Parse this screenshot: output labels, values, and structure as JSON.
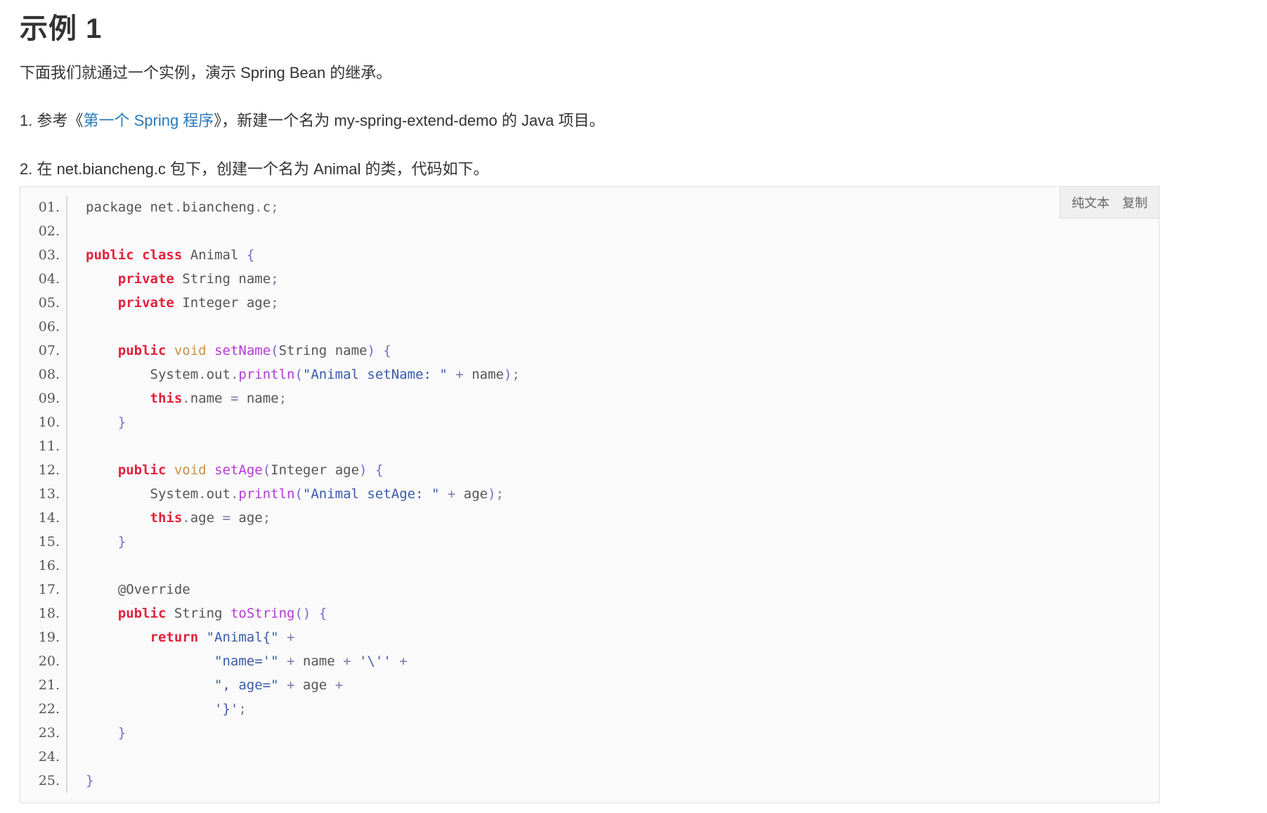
{
  "heading": "示例 1",
  "intro": "下面我们就通过一个实例，演示 Spring Bean 的继承。",
  "step1": {
    "prefix": "1. 参考《",
    "link": "第一个 Spring 程序",
    "suffix": "》，新建一个名为 my-spring-extend-demo 的 Java 项目。"
  },
  "step2": "2. 在 net.biancheng.c 包下，创建一个名为 Animal 的类，代码如下。",
  "toolbar": {
    "plain_text": "纯文本",
    "copy": "复制"
  },
  "code_lines": [
    {
      "n": "01.",
      "t": "package net.biancheng.c;"
    },
    {
      "n": "02.",
      "t": ""
    },
    {
      "n": "03.",
      "t": "public class Animal {"
    },
    {
      "n": "04.",
      "t": "    private String name;"
    },
    {
      "n": "05.",
      "t": "    private Integer age;"
    },
    {
      "n": "06.",
      "t": ""
    },
    {
      "n": "07.",
      "t": "    public void setName(String name) {"
    },
    {
      "n": "08.",
      "t": "        System.out.println(\"Animal setName: \" + name);"
    },
    {
      "n": "09.",
      "t": "        this.name = name;"
    },
    {
      "n": "10.",
      "t": "    }"
    },
    {
      "n": "11.",
      "t": ""
    },
    {
      "n": "12.",
      "t": "    public void setAge(Integer age) {"
    },
    {
      "n": "13.",
      "t": "        System.out.println(\"Animal setAge: \" + age);"
    },
    {
      "n": "14.",
      "t": "        this.age = age;"
    },
    {
      "n": "15.",
      "t": "    }"
    },
    {
      "n": "16.",
      "t": ""
    },
    {
      "n": "17.",
      "t": "    @Override"
    },
    {
      "n": "18.",
      "t": "    public String toString() {"
    },
    {
      "n": "19.",
      "t": "        return \"Animal{\" +"
    },
    {
      "n": "20.",
      "t": "                \"name='\" + name + '\\'' +"
    },
    {
      "n": "21.",
      "t": "                \", age=\" + age +"
    },
    {
      "n": "22.",
      "t": "                '}';"
    },
    {
      "n": "23.",
      "t": "    }"
    },
    {
      "n": "24.",
      "t": ""
    },
    {
      "n": "25.",
      "t": "}"
    }
  ],
  "colors": {
    "keyword": "#e3213c",
    "type_keyword": "#c9914a",
    "method": "#b33bd7",
    "punctuation": "#7966d7",
    "string": "#3d5ba8",
    "link": "#2a7ab8",
    "code_background": "#fafafa"
  }
}
